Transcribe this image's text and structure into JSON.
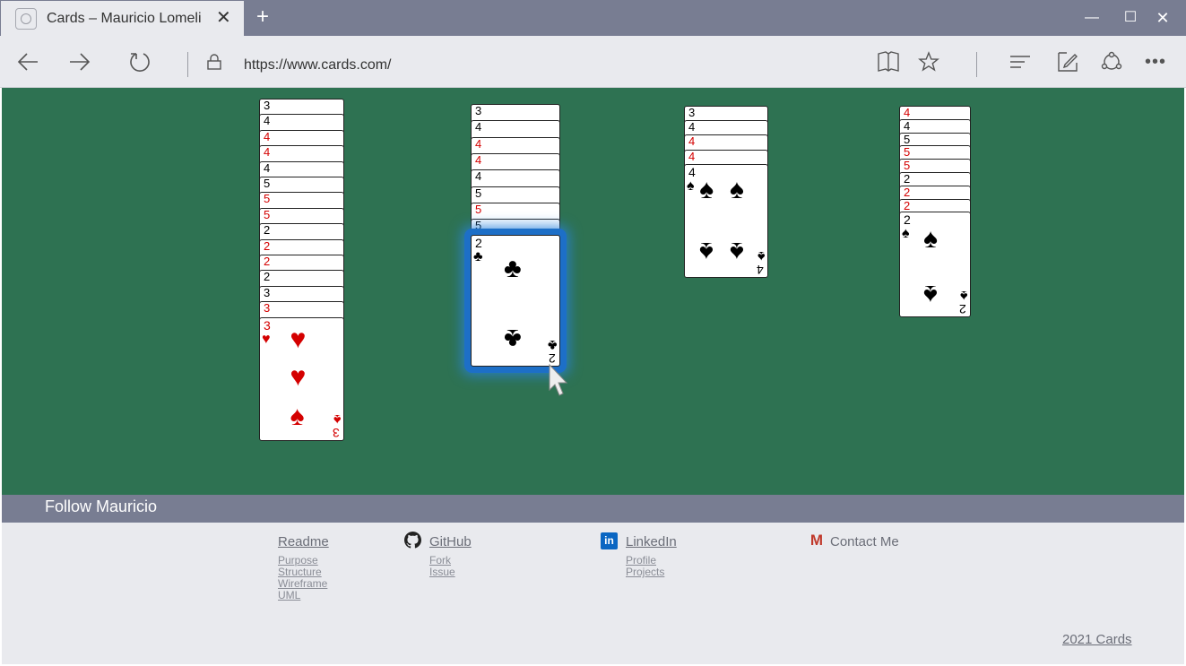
{
  "browser": {
    "tab_title": "Cards – Mauricio Lomeli",
    "tab_close": "✕",
    "new_tab": "+",
    "url": "https://www.cards.com/",
    "minimize": "—",
    "maximize": "☐",
    "close": "✕"
  },
  "colors": {
    "table": "#2e7252",
    "red_suit": "#d40000",
    "selection": "#1d6fc7",
    "chrome": "#787d92"
  },
  "piles": [
    {
      "stack": [
        {
          "rank": "3",
          "color": "black"
        },
        {
          "rank": "4",
          "color": "black"
        },
        {
          "rank": "4",
          "color": "red"
        },
        {
          "rank": "4",
          "color": "red"
        },
        {
          "rank": "4",
          "color": "black"
        },
        {
          "rank": "5",
          "color": "black"
        },
        {
          "rank": "5",
          "color": "red"
        },
        {
          "rank": "5",
          "color": "red"
        },
        {
          "rank": "2",
          "color": "black"
        },
        {
          "rank": "2",
          "color": "red"
        },
        {
          "rank": "2",
          "color": "red"
        },
        {
          "rank": "2",
          "color": "black"
        },
        {
          "rank": "3",
          "color": "black"
        },
        {
          "rank": "3",
          "color": "red"
        }
      ],
      "top": {
        "rank": "3",
        "suit": "♥",
        "bottom_suit": "♠",
        "color": "red"
      }
    },
    {
      "stack": [
        {
          "rank": "3",
          "color": "black"
        },
        {
          "rank": "4",
          "color": "black"
        },
        {
          "rank": "4",
          "color": "red"
        },
        {
          "rank": "4",
          "color": "red"
        },
        {
          "rank": "4",
          "color": "black"
        },
        {
          "rank": "5",
          "color": "black"
        },
        {
          "rank": "5",
          "color": "red"
        },
        {
          "rank": "5",
          "color": "black"
        }
      ],
      "top": {
        "rank": "2",
        "suit": "♣",
        "color": "black",
        "selected": true
      }
    },
    {
      "stack": [
        {
          "rank": "3",
          "color": "black"
        },
        {
          "rank": "4",
          "color": "black"
        },
        {
          "rank": "4",
          "color": "red"
        },
        {
          "rank": "4",
          "color": "red"
        }
      ],
      "top": {
        "rank": "4",
        "suit": "♠",
        "color": "black"
      }
    },
    {
      "stack": [
        {
          "rank": "4",
          "color": "red"
        },
        {
          "rank": "4",
          "color": "black"
        },
        {
          "rank": "5",
          "color": "black"
        },
        {
          "rank": "5",
          "color": "red"
        },
        {
          "rank": "5",
          "color": "red"
        },
        {
          "rank": "2",
          "color": "black"
        },
        {
          "rank": "2",
          "color": "red"
        },
        {
          "rank": "2",
          "color": "red"
        }
      ],
      "top": {
        "rank": "2",
        "suit": "♠",
        "color": "black"
      }
    }
  ],
  "follow": {
    "label": "Follow Mauricio"
  },
  "footer": {
    "readme": {
      "label": "Readme",
      "links": [
        "Purpose",
        "Structure",
        "Wireframe",
        "UML"
      ]
    },
    "github": {
      "label": "GitHub",
      "links": [
        "Fork",
        "Issue"
      ]
    },
    "linkedin": {
      "label": "LinkedIn",
      "icon_text": "in",
      "links": [
        "Profile",
        "Projects"
      ]
    },
    "contact": {
      "label": "Contact Me",
      "icon_text": "M"
    },
    "copyright": "2021 Cards"
  }
}
